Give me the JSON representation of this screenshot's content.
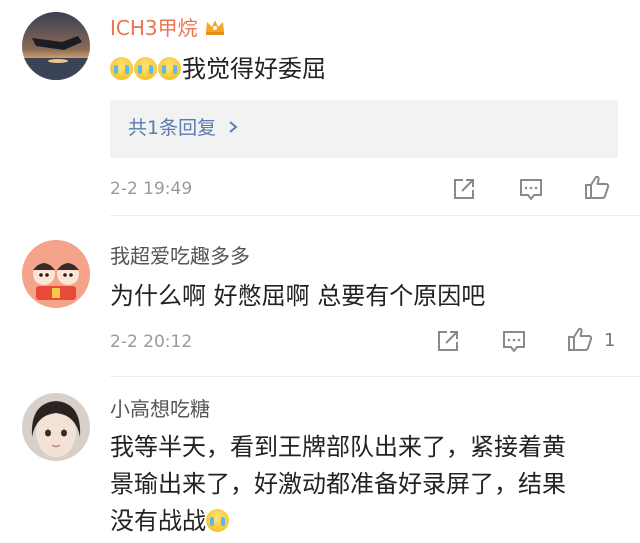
{
  "comments": [
    {
      "username": "ICH3甲烷",
      "text": "我觉得好委屈",
      "emoji_count_before": 3,
      "reply_summary": "共1条回复",
      "timestamp": "2-2 19:49",
      "like_count": ""
    },
    {
      "username": "我超爱吃趣多多",
      "text": "为什么啊 好憋屈啊 总要有个原因吧",
      "timestamp": "2-2 20:12",
      "like_count": "1"
    },
    {
      "username": "小高想吃糖",
      "text_line1": "我等半天，看到王牌部队出来了，紧接着黄",
      "text_line2": "景瑜出来了，好激动都准备好录屏了，结果",
      "text_line3": "没有战战"
    }
  ],
  "icons": {
    "share": "share-icon",
    "comment": "comment-icon",
    "like": "thumbs-up-icon",
    "badge": "crown-badge-icon",
    "emoji": "crying-emoji-icon"
  },
  "colors": {
    "vip_name": "#eb7350",
    "link": "#5b7cae",
    "meta": "#9a9a9a"
  }
}
